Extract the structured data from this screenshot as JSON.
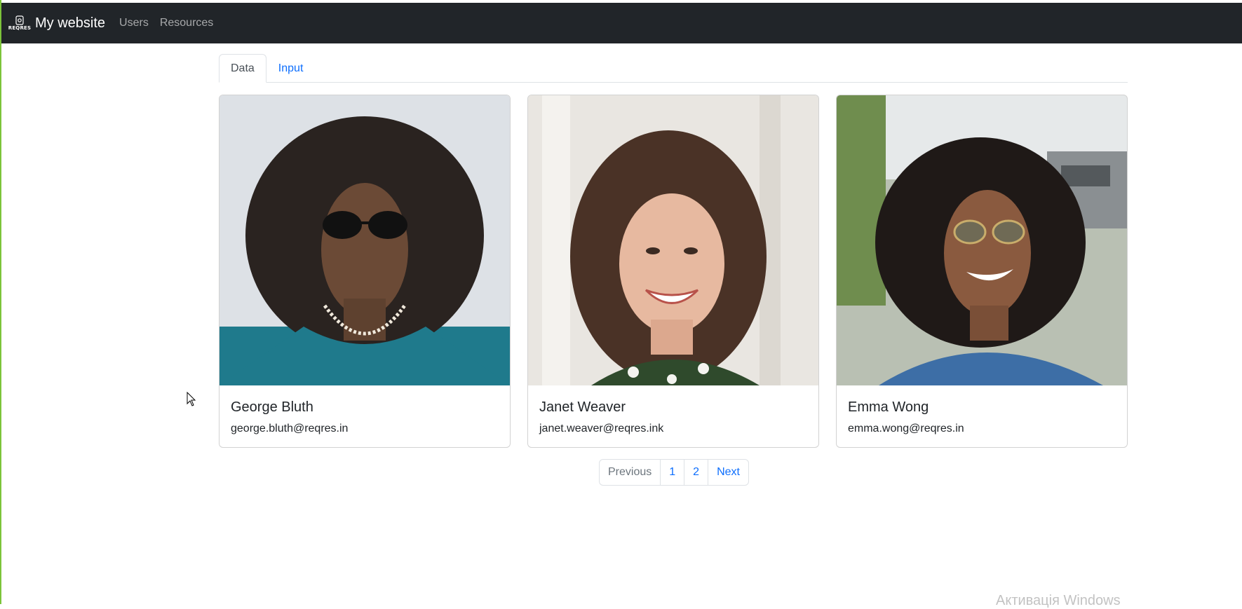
{
  "navbar": {
    "logo_text": "REQRES",
    "brand": "My website",
    "links": [
      "Users",
      "Resources"
    ]
  },
  "tabs": [
    {
      "label": "Data",
      "active": true
    },
    {
      "label": "Input",
      "active": false
    }
  ],
  "cards": [
    {
      "name": "George Bluth",
      "email": "george.bluth@reqres.in"
    },
    {
      "name": "Janet Weaver",
      "email": "janet.weaver@reqres.ink"
    },
    {
      "name": "Emma Wong",
      "email": "emma.wong@reqres.in"
    }
  ],
  "pagination": {
    "previous": "Previous",
    "pages": [
      "1",
      "2"
    ],
    "next": "Next"
  },
  "watermark": "Активація Windows",
  "colors": {
    "navbar_bg": "#212529",
    "link": "#0d6efd",
    "left_edge": "#7cc43a"
  }
}
